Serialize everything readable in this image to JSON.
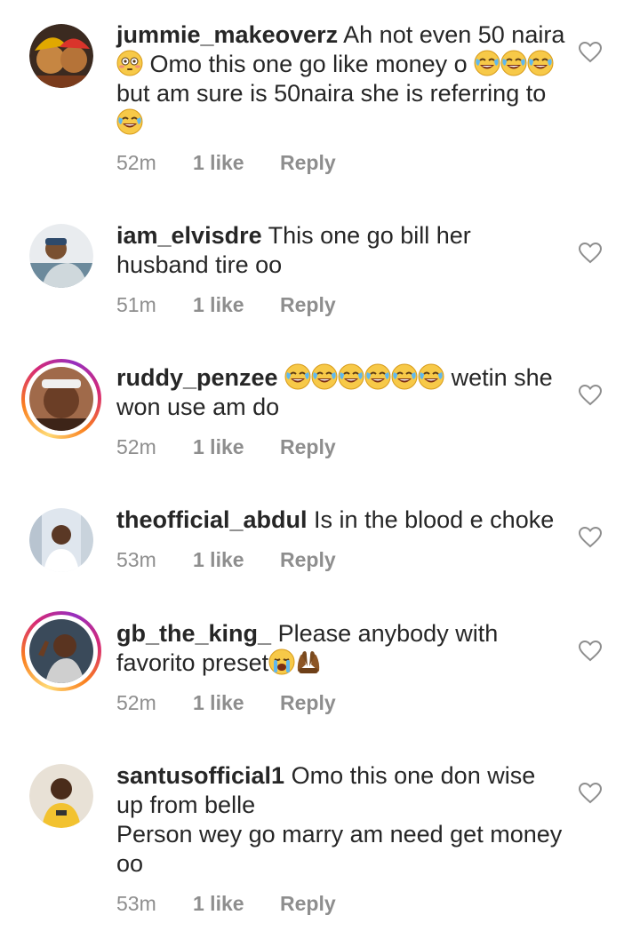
{
  "comments": [
    {
      "username": "jummie_makeoverz",
      "text_parts": [
        "Ah not even 50 naira ",
        "😳",
        " Omo this one go like money o ",
        "😂😂😂",
        " but am sure is 50naira she is referring to ",
        "😂"
      ],
      "time": "52m",
      "likes": "1 like",
      "reply": "Reply"
    },
    {
      "username": "iam_elvisdre",
      "text_parts": [
        "This one go bill her husband tire oo"
      ],
      "time": "51m",
      "likes": "1 like",
      "reply": "Reply"
    },
    {
      "username": "ruddy_penzee",
      "text_parts": [
        "😂😂😂😂😂😂",
        " wetin she won use am do"
      ],
      "time": "52m",
      "likes": "1 like",
      "reply": "Reply"
    },
    {
      "username": "theofficial_abdul",
      "text_parts": [
        "Is in the blood e choke"
      ],
      "time": "53m",
      "likes": "1 like",
      "reply": "Reply"
    },
    {
      "username": "gb_the_king_",
      "text_parts": [
        "Please anybody with favorito preset",
        "😭🤲🏾"
      ],
      "time": "52m",
      "likes": "1 like",
      "reply": "Reply"
    },
    {
      "username": "santusofficial1",
      "text_parts": [
        "Omo this one don wise up from belle",
        "Person wey go marry am need get money oo"
      ],
      "time": "53m",
      "likes": "1 like",
      "reply": "Reply"
    }
  ],
  "colors": {
    "text": "#262626",
    "meta": "#8e8e8e",
    "story_ring": [
      "#feda75",
      "#fa7e1e",
      "#d62976",
      "#962fbf"
    ]
  },
  "icons": {
    "like": "heart-outline-icon"
  }
}
